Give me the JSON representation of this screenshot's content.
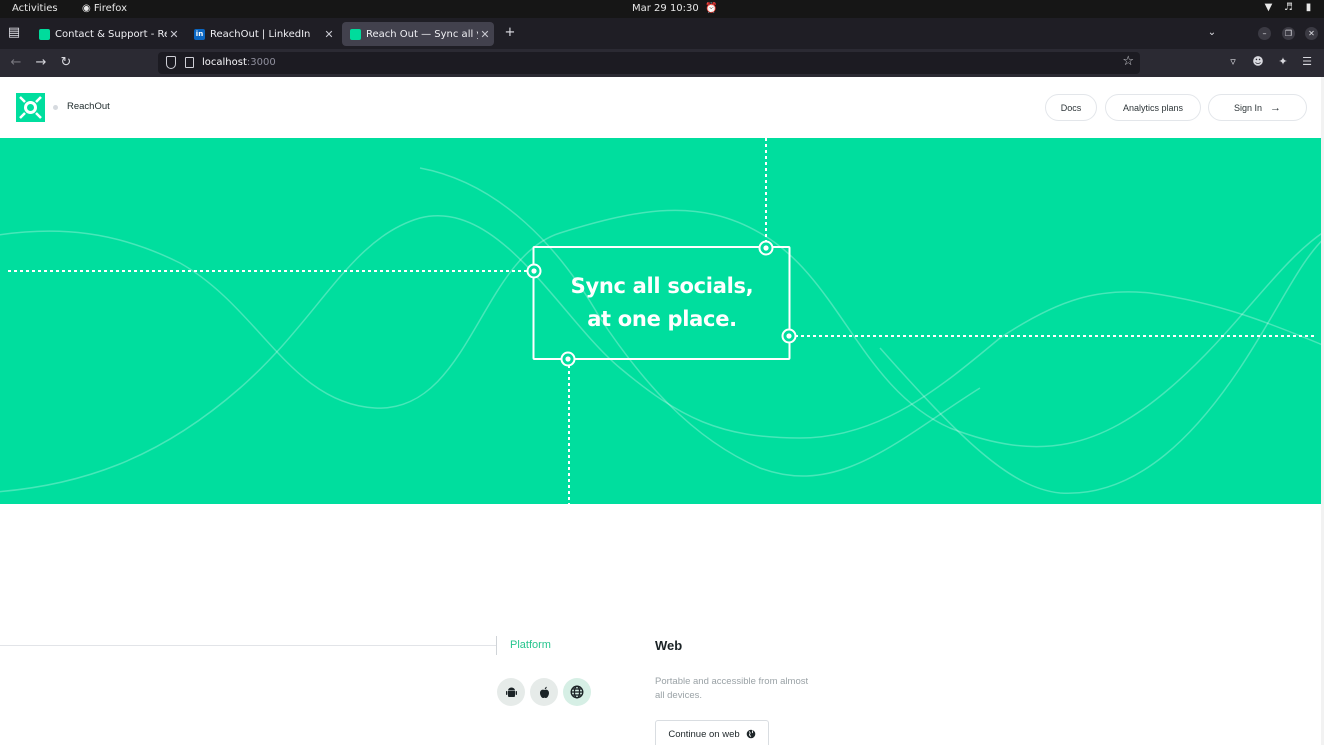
{
  "os": {
    "activities": "Activities",
    "app_name": "Firefox",
    "clock": "Mar 29  10:30"
  },
  "browser": {
    "tabs": [
      {
        "title": "Contact & Support - Reac",
        "favicon": "reachout-logo"
      },
      {
        "title": "ReachOut | LinkedIn",
        "favicon": "linkedin-logo"
      },
      {
        "title": "Reach Out — Sync all you",
        "favicon": "reachout-logo",
        "active": true
      }
    ],
    "url_host": "localhost",
    "url_port": ":3000"
  },
  "site": {
    "brand": "ReachOut",
    "nav": {
      "docs": "Docs",
      "analytics": "Analytics plans",
      "sign_in": "Sign In"
    },
    "hero": {
      "line1": "Sync all socials,",
      "line2": "at one place."
    },
    "platform": {
      "label": "Platform",
      "icons": [
        "android-icon",
        "apple-icon",
        "globe-icon"
      ],
      "selected": "globe-icon",
      "title": "Web",
      "description": "Portable and accessible from almost all devices.",
      "button": "Continue on web"
    }
  },
  "colors": {
    "brand_green": "#00de9e",
    "accent_text": "#27c58e"
  }
}
